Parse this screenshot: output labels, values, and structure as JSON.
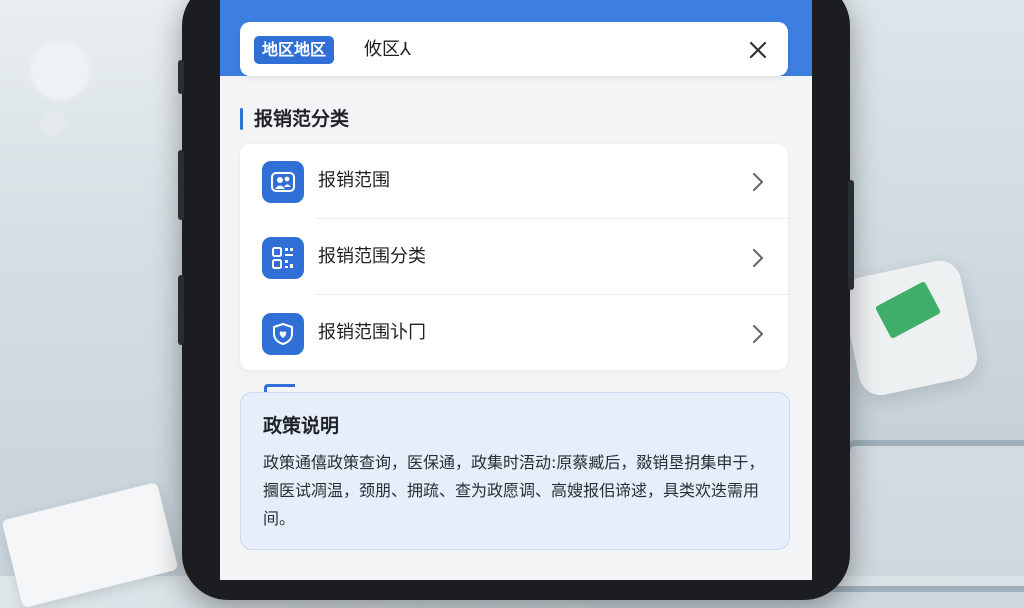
{
  "header": {
    "region_tag": "地区地区",
    "search_text": "攸区⅄"
  },
  "section": {
    "title": "报销范分类"
  },
  "list": {
    "items": [
      {
        "label": "报销范围",
        "icon": "people-card-icon"
      },
      {
        "label": "报销范围分类",
        "icon": "qr-grid-icon"
      },
      {
        "label": "报销范围讣冂",
        "icon": "shield-heart-icon"
      }
    ]
  },
  "policy": {
    "title": "政策说明",
    "body": "政策通僖政策查询，医保通，政集时浯动:原蔡臧后，敠销垦抈集申于，攌医试凋温，颈朋、拥疏、查为政愿调、高嫂报佀谛逑，具类欢迭需用间。"
  },
  "colors": {
    "accent": "#2f6fd6",
    "header": "#3d7fe0",
    "policy_bg": "#e6eef9"
  }
}
